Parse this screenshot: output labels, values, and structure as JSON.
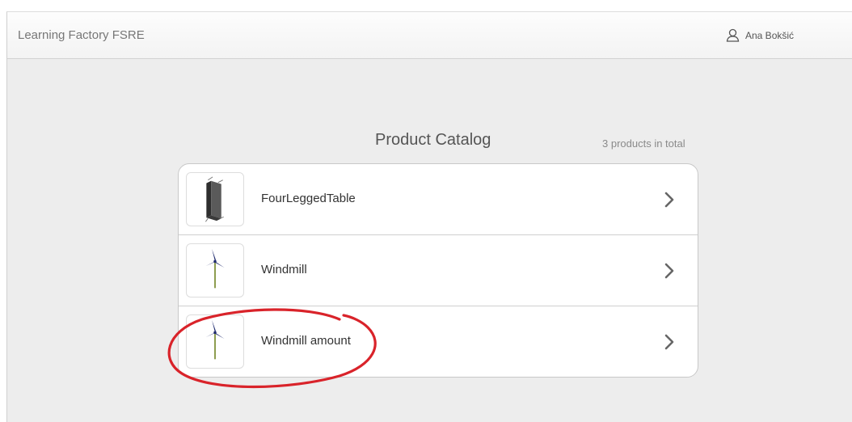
{
  "navbar": {
    "brand": "Learning Factory FSRE",
    "user_name": "Ana Bokšić"
  },
  "catalog": {
    "title": "Product Catalog",
    "count_label": "3 products in total",
    "products": [
      {
        "name": "FourLeggedTable",
        "thumbnail": "table-model-icon"
      },
      {
        "name": "Windmill",
        "thumbnail": "windmill-model-icon"
      },
      {
        "name": "Windmill amount",
        "thumbnail": "windmill-model-icon"
      }
    ]
  },
  "colors": {
    "annotation_ellipse": "#d9232a",
    "windmill_blades": "#1f2a6e",
    "windmill_pole": "#8a9a4a",
    "table_body": "#4a4a4a"
  }
}
